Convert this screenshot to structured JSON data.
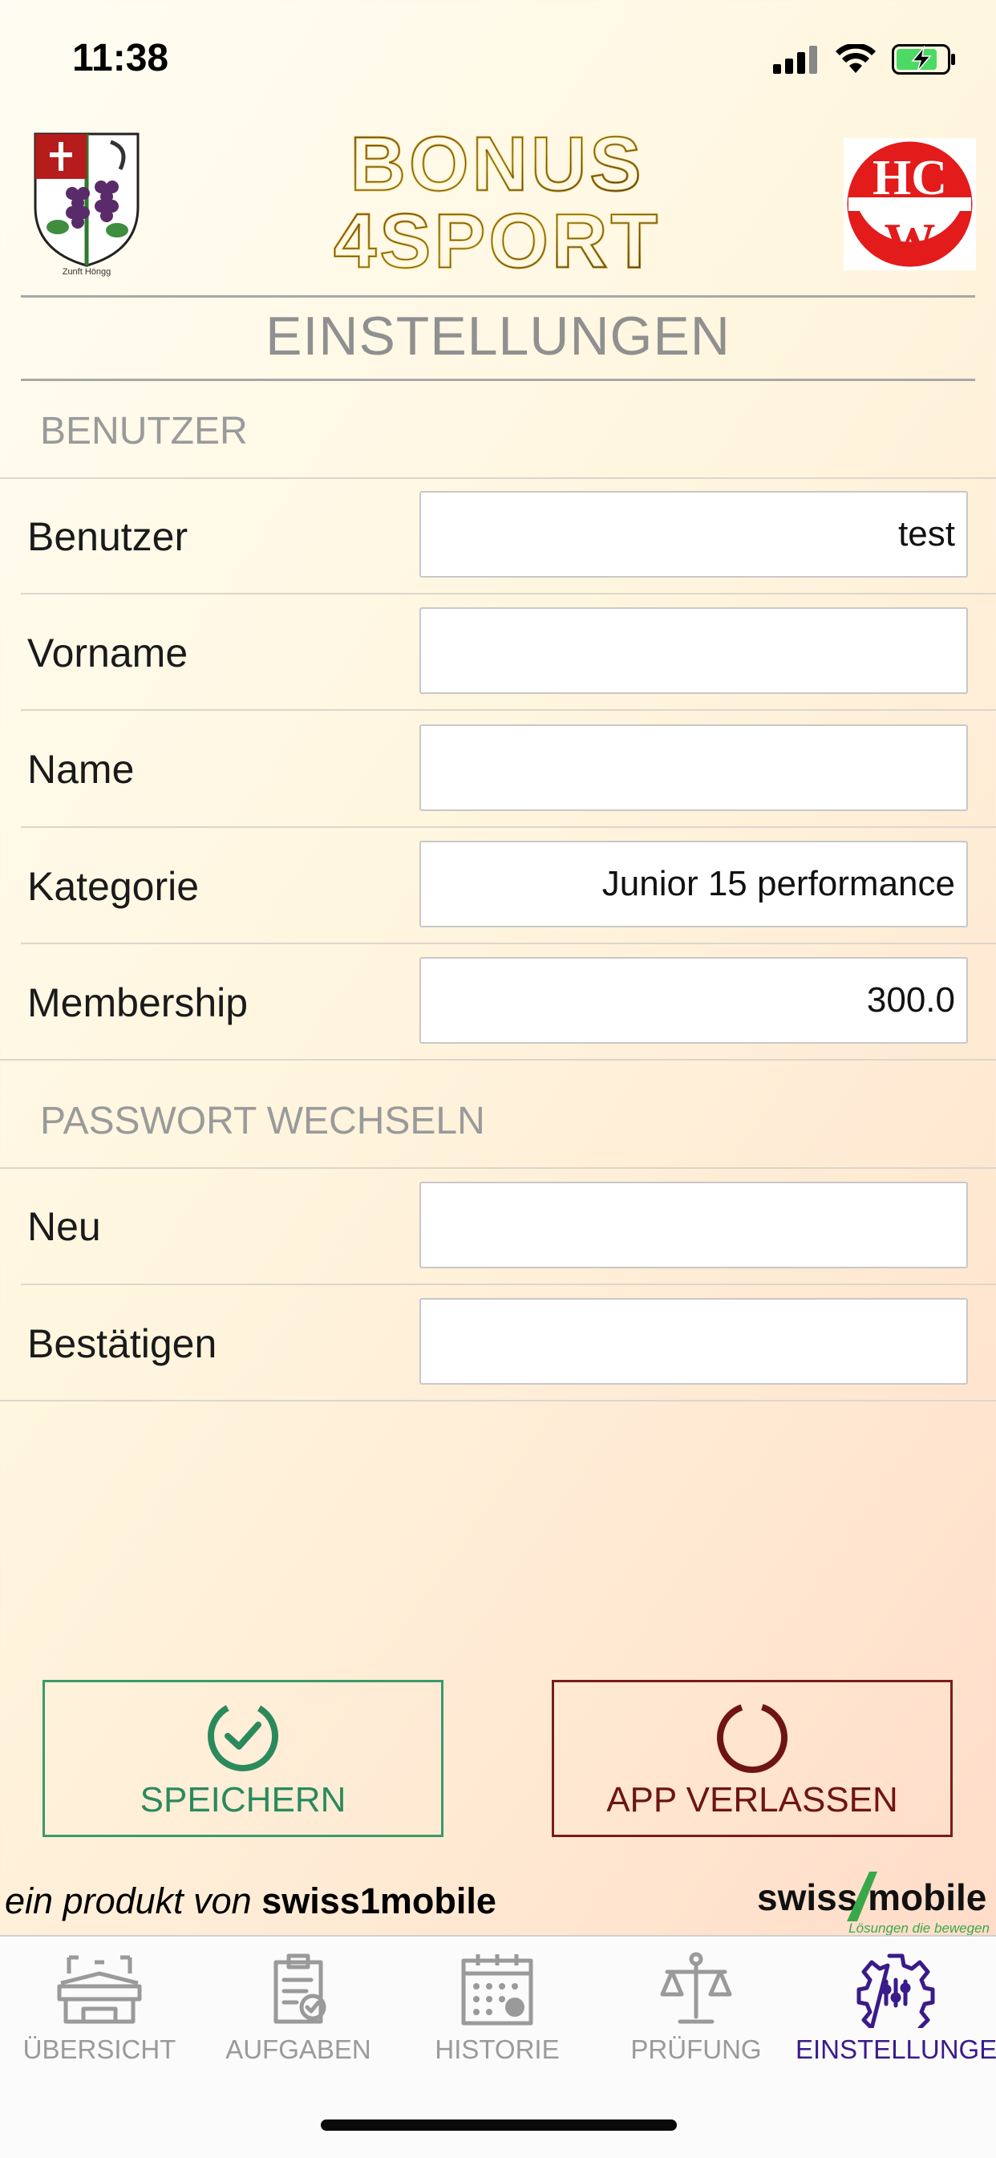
{
  "status": {
    "time": "11:38"
  },
  "header": {
    "crest_caption": "Zunft Höngg",
    "brand_line1": "BONUS",
    "brand_line2": "4SPORT",
    "club_logo_text": "HCW",
    "page_title": "EINSTELLUNGEN"
  },
  "sections": {
    "user": {
      "title": "BENUTZER",
      "rows": [
        {
          "label": "Benutzer",
          "value": "test"
        },
        {
          "label": "Vorname",
          "value": ""
        },
        {
          "label": "Name",
          "value": ""
        },
        {
          "label": "Kategorie",
          "value": "Junior 15 performance"
        },
        {
          "label": "Membership",
          "value": "300.0"
        }
      ]
    },
    "password": {
      "title": "PASSWORT WECHSELN",
      "rows": [
        {
          "label": "Neu",
          "value": ""
        },
        {
          "label": "Bestätigen",
          "value": ""
        }
      ]
    }
  },
  "actions": {
    "save_label": "SPEICHERN",
    "quit_label": "APP VERLASSEN"
  },
  "footer": {
    "prefix": "ein produkt von",
    "company": "swiss1mobile",
    "logo_text": "swiss mobile",
    "logo_tagline": "Lösungen die bewegen"
  },
  "tabs": [
    {
      "label": "ÜBERSICHT",
      "icon": "stadium-icon",
      "active": false
    },
    {
      "label": "AUFGABEN",
      "icon": "clipboard-icon",
      "active": false
    },
    {
      "label": "HISTORIE",
      "icon": "calendar-icon",
      "active": false
    },
    {
      "label": "PRÜFUNG",
      "icon": "scale-icon",
      "active": false
    },
    {
      "label": "EINSTELLUNGEN",
      "icon": "settings-gear-icon",
      "active": true
    }
  ],
  "colors": {
    "save": "#2b8a5c",
    "quit": "#6e1414",
    "tab_active": "#3a1b8a",
    "tab_inactive": "#9a9a9a",
    "club_red": "#e31b1b"
  }
}
